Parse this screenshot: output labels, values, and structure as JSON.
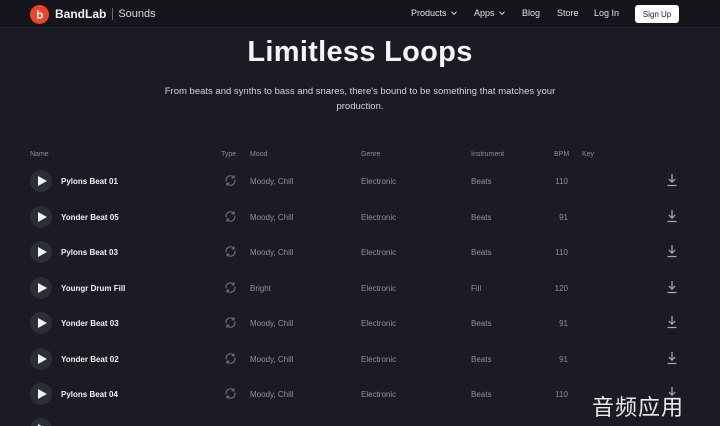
{
  "nav": {
    "brand": "BandLab",
    "section": "Sounds",
    "links": [
      {
        "label": "Products",
        "dropdown": true
      },
      {
        "label": "Apps",
        "dropdown": true
      },
      {
        "label": "Blog",
        "dropdown": false
      },
      {
        "label": "Store",
        "dropdown": false
      },
      {
        "label": "Log In",
        "dropdown": false
      }
    ],
    "signup": "Sign Up",
    "accent": "#f0412b"
  },
  "hero": {
    "title": "Limitless Loops",
    "subtitle": "From beats and synths to bass and snares, there's bound to be something that matches your production."
  },
  "table": {
    "headers": [
      "Name",
      "Type",
      "Mood",
      "Genre",
      "Instrument",
      "BPM",
      "Key"
    ],
    "rows": [
      {
        "name": "Pylons Beat 01",
        "mood": "Moody, Chill",
        "genre": "Electronic",
        "instrument": "Beats",
        "bpm": "110",
        "key": ""
      },
      {
        "name": "Yonder Beat 05",
        "mood": "Moody, Chill",
        "genre": "Electronic",
        "instrument": "Beats",
        "bpm": "91",
        "key": ""
      },
      {
        "name": "Pylons Beat 03",
        "mood": "Moody, Chill",
        "genre": "Electronic",
        "instrument": "Beats",
        "bpm": "110",
        "key": ""
      },
      {
        "name": "Youngr Drum Fill",
        "mood": "Bright",
        "genre": "Electronic",
        "instrument": "Fill",
        "bpm": "120",
        "key": ""
      },
      {
        "name": "Yonder Beat 03",
        "mood": "Moody, Chill",
        "genre": "Electronic",
        "instrument": "Beats",
        "bpm": "91",
        "key": ""
      },
      {
        "name": "Yonder Beat 02",
        "mood": "Moody, Chill",
        "genre": "Electronic",
        "instrument": "Beats",
        "bpm": "91",
        "key": ""
      },
      {
        "name": "Pylons Beat 04",
        "mood": "Moody, Chill",
        "genre": "Electronic",
        "instrument": "Beats",
        "bpm": "110",
        "key": ""
      }
    ],
    "icons": {
      "play": "play-icon",
      "type": "loop-icon",
      "download": "download-icon"
    }
  },
  "watermark": "音频应用"
}
